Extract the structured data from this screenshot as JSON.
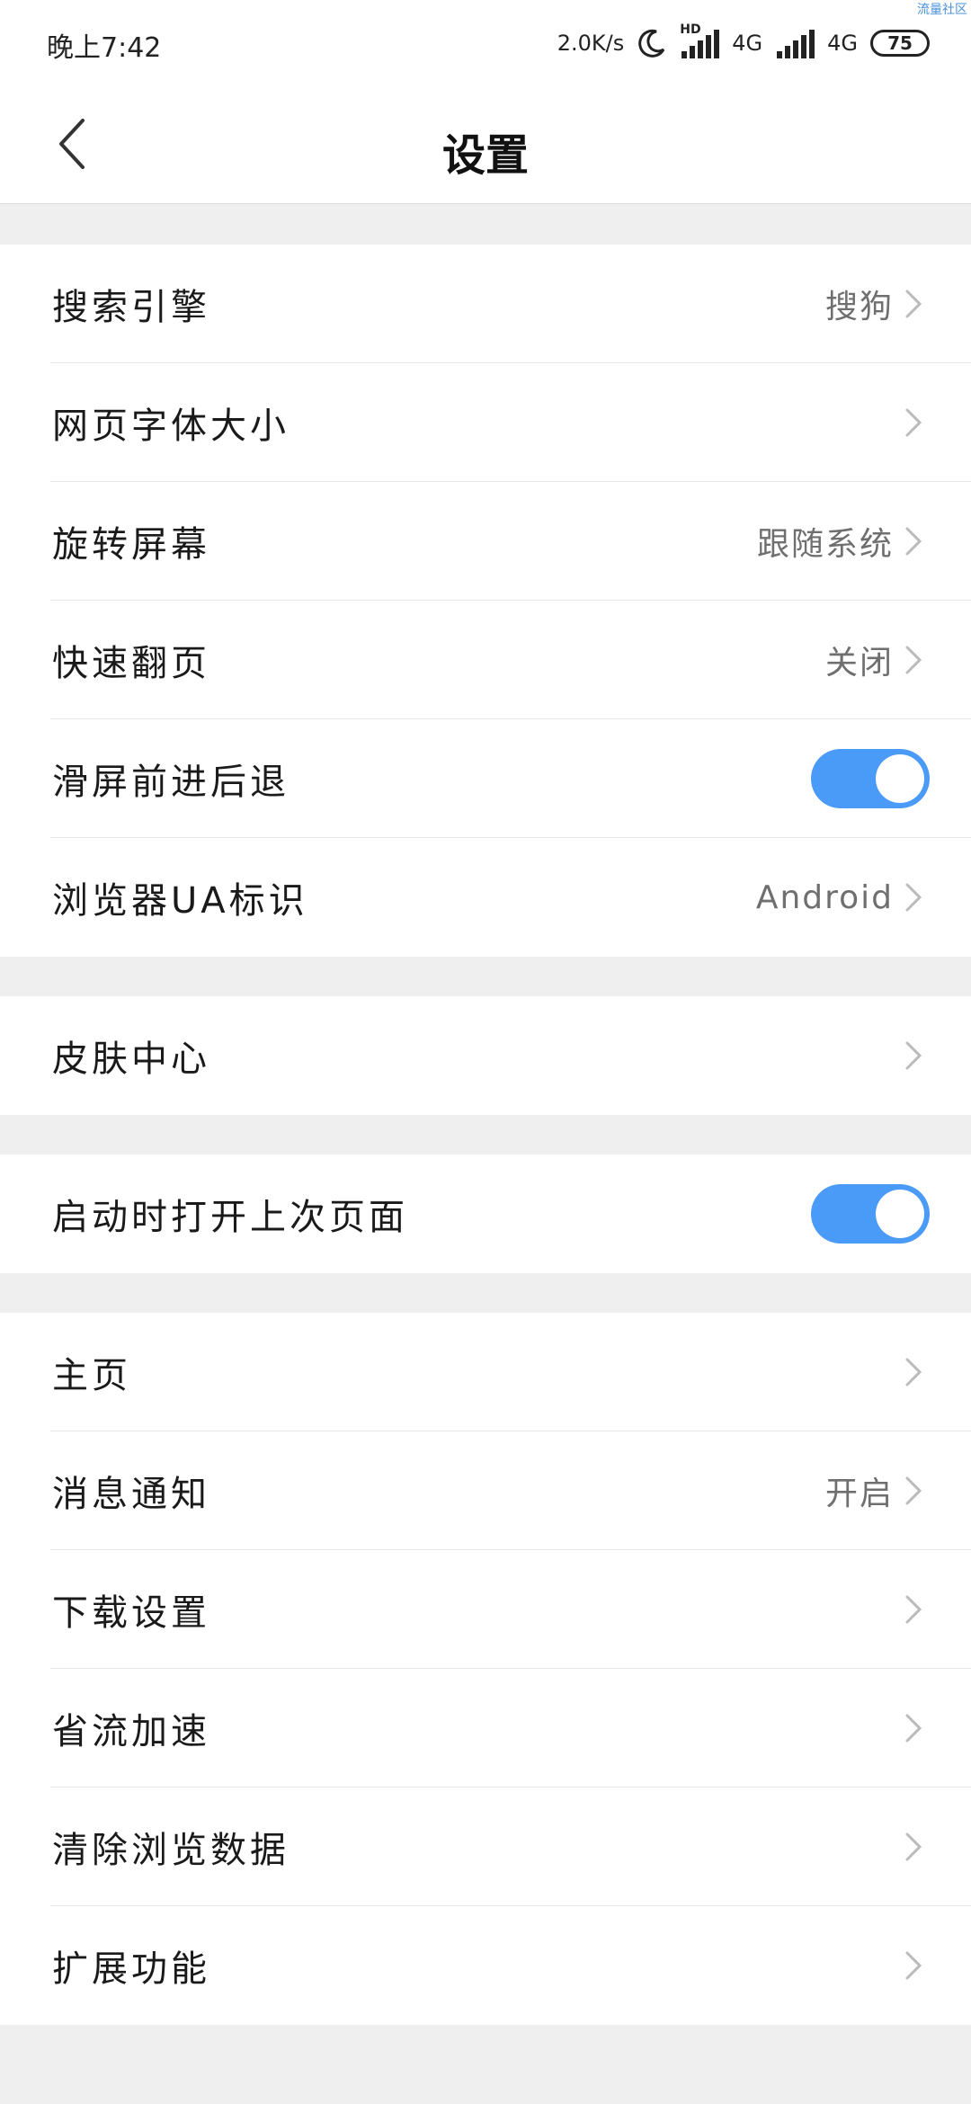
{
  "status_bar": {
    "time": "晚上7:42",
    "net_speed": "2.0K/s",
    "hd_label": "HD",
    "network1": "4G",
    "network2": "4G",
    "battery": "75",
    "corner_mark": "流量社区"
  },
  "header": {
    "title": "设置"
  },
  "groups": [
    {
      "rows": [
        {
          "label": "搜索引擎",
          "value": "搜狗"
        },
        {
          "label": "网页字体大小",
          "value": ""
        },
        {
          "label": "旋转屏幕",
          "value": "跟随系统"
        },
        {
          "label": "快速翻页",
          "value": "关闭"
        },
        {
          "label": "滑屏前进后退",
          "toggle": true
        },
        {
          "label": "浏览器UA标识",
          "value": "Android"
        }
      ]
    },
    {
      "rows": [
        {
          "label": "皮肤中心",
          "value": ""
        }
      ]
    },
    {
      "rows": [
        {
          "label": "启动时打开上次页面",
          "toggle": true
        }
      ]
    },
    {
      "rows": [
        {
          "label": "主页",
          "value": ""
        },
        {
          "label": "消息通知",
          "value": "开启"
        },
        {
          "label": "下载设置",
          "value": ""
        },
        {
          "label": "省流加速",
          "value": ""
        },
        {
          "label": "清除浏览数据",
          "value": ""
        },
        {
          "label": "扩展功能",
          "value": ""
        }
      ]
    }
  ],
  "colors": {
    "toggle_on": "#4a9af7",
    "background": "#efefef"
  }
}
